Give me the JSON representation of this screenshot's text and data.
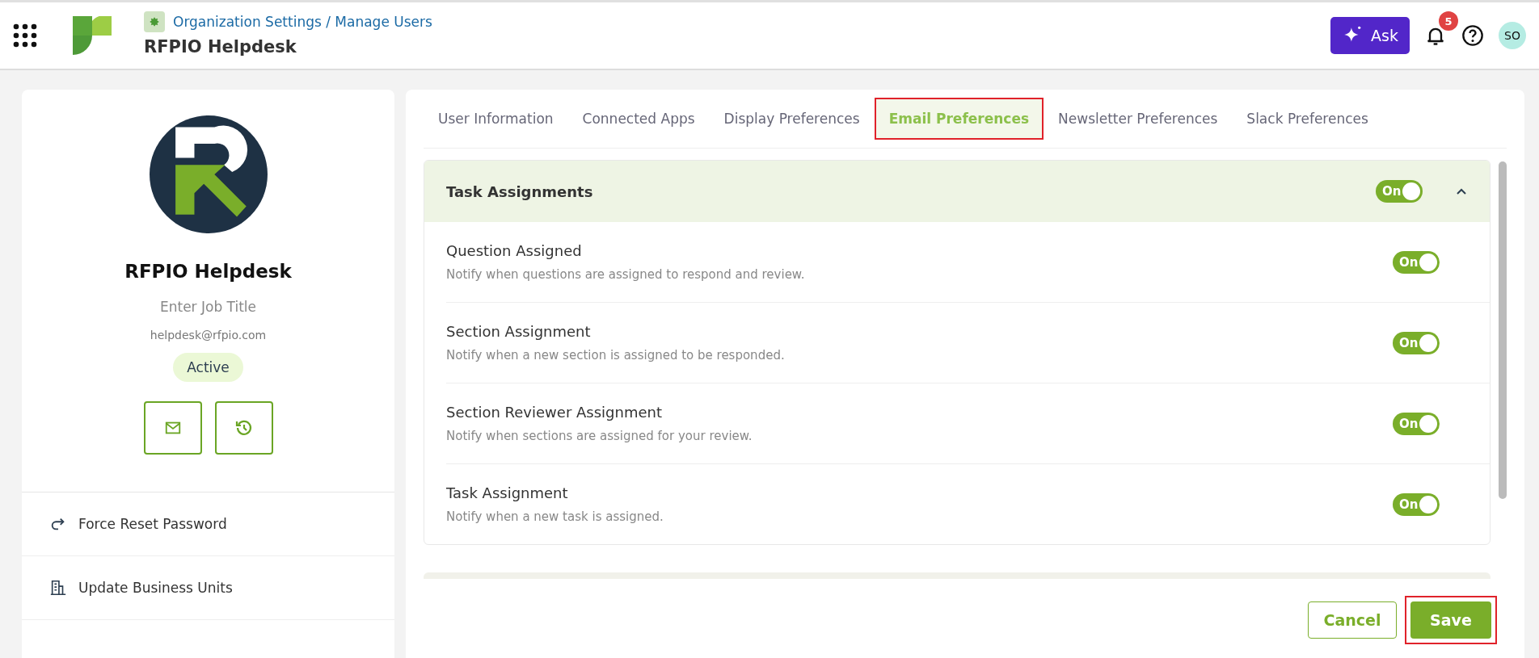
{
  "header": {
    "breadcrumb": "Organization Settings / Manage Users",
    "title": "RFPIO Helpdesk",
    "ask_button": "Ask",
    "notification_count": "5",
    "avatar_initials": "SO"
  },
  "profile": {
    "name": "RFPIO Helpdesk",
    "job_title_placeholder": "Enter Job Title",
    "email": "helpdesk@rfpio.com",
    "status": "Active",
    "actions": [
      {
        "kind": "reset",
        "label": "Force Reset Password"
      },
      {
        "kind": "units",
        "label": "Update Business Units"
      }
    ]
  },
  "tabs": [
    {
      "label": "User Information",
      "selected": false,
      "highlighted": false
    },
    {
      "label": "Connected Apps",
      "selected": false,
      "highlighted": false
    },
    {
      "label": "Display Preferences",
      "selected": false,
      "highlighted": false
    },
    {
      "label": "Email Preferences",
      "selected": true,
      "highlighted": true
    },
    {
      "label": "Newsletter Preferences",
      "selected": false,
      "highlighted": false
    },
    {
      "label": "Slack Preferences",
      "selected": false,
      "highlighted": false
    }
  ],
  "section": {
    "title": "Task Assignments",
    "on": true,
    "toggle_label": "On",
    "expanded": true,
    "items": [
      {
        "title": "Question Assigned",
        "description": "Notify when questions are assigned to respond and review.",
        "on": true,
        "toggle_label": "On"
      },
      {
        "title": "Section Assignment",
        "description": "Notify when a new section is assigned to be responded.",
        "on": true,
        "toggle_label": "On"
      },
      {
        "title": "Section Reviewer Assignment",
        "description": "Notify when sections are assigned for your review.",
        "on": true,
        "toggle_label": "On"
      },
      {
        "title": "Task Assignment",
        "description": "Notify when a new task is assigned.",
        "on": true,
        "toggle_label": "On"
      }
    ]
  },
  "footer": {
    "cancel": "Cancel",
    "save": "Save",
    "save_highlighted": true
  }
}
